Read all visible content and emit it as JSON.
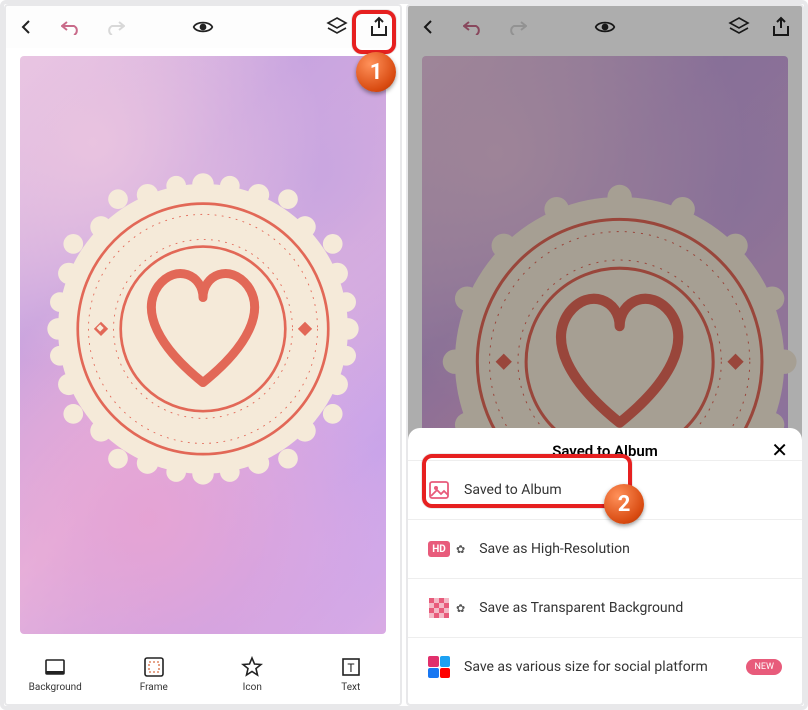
{
  "toolbar": {
    "tools": [
      {
        "label": "Background"
      },
      {
        "label": "Frame"
      },
      {
        "label": "Icon"
      },
      {
        "label": "Text"
      }
    ]
  },
  "panel": {
    "title": "Saved to Album",
    "rows": [
      {
        "label": "Saved to Album"
      },
      {
        "label": "Save as High-Resolution",
        "badge": "HD"
      },
      {
        "label": "Save as Transparent Background"
      },
      {
        "label": "Save as various size for social platform",
        "tag": "NEW"
      }
    ]
  },
  "callouts": {
    "one": "1",
    "two": "2"
  }
}
